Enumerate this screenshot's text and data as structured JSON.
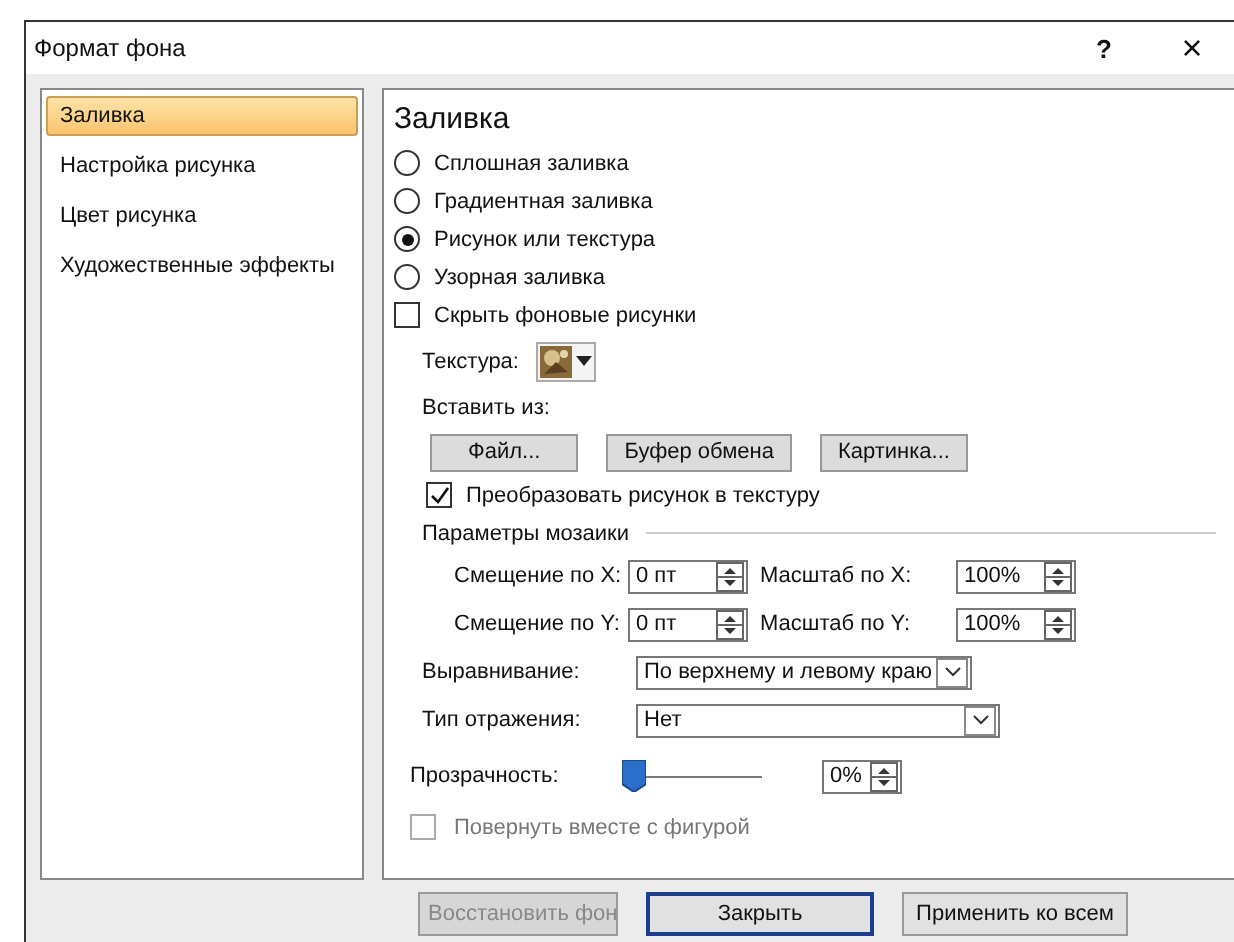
{
  "window": {
    "title": "Формат фона",
    "help": "?",
    "close": "×"
  },
  "sidebar": {
    "items": [
      {
        "label": "Заливка",
        "selected": true
      },
      {
        "label": "Настройка рисунка",
        "selected": false
      },
      {
        "label": "Цвет рисунка",
        "selected": false
      },
      {
        "label": "Художественные эффекты",
        "selected": false
      }
    ]
  },
  "panel": {
    "heading": "Заливка",
    "fill_options": [
      {
        "label": "Сплошная заливка",
        "selected": false
      },
      {
        "label": "Градиентная заливка",
        "selected": false
      },
      {
        "label": "Рисунок или текстура",
        "selected": true
      },
      {
        "label": "Узорная заливка",
        "selected": false
      }
    ],
    "hide_background": {
      "label": "Скрыть фоновые рисунки",
      "checked": false
    },
    "texture_label": "Текстура:",
    "insert_from": {
      "label": "Вставить из:",
      "buttons": [
        "Файл...",
        "Буфер обмена",
        "Картинка..."
      ]
    },
    "tile": {
      "label": "Преобразовать рисунок в текстуру",
      "checked": true
    },
    "tiling": {
      "title": "Параметры мозаики",
      "offset_x": {
        "label": "Смещение по X:",
        "value": "0 пт"
      },
      "scale_x": {
        "label": "Масштаб по X:",
        "value": "100%"
      },
      "offset_y": {
        "label": "Смещение по Y:",
        "value": "0 пт"
      },
      "scale_y": {
        "label": "Масштаб по Y:",
        "value": "100%"
      },
      "alignment": {
        "label": "Выравнивание:",
        "value": "По верхнему и левому краю"
      },
      "mirror": {
        "label": "Тип отражения:",
        "value": "Нет"
      }
    },
    "transparency": {
      "label": "Прозрачность:",
      "level": 0,
      "value": "0%"
    },
    "rotate": {
      "label": "Повернуть вместе с фигурой",
      "checked": false,
      "disabled": true
    }
  },
  "buttons": [
    {
      "label": "Восстановить фон",
      "disabled": true,
      "default": false
    },
    {
      "label": "Закрыть",
      "disabled": false,
      "default": true
    },
    {
      "label": "Применить ко всем",
      "disabled": false,
      "default": false
    }
  ]
}
